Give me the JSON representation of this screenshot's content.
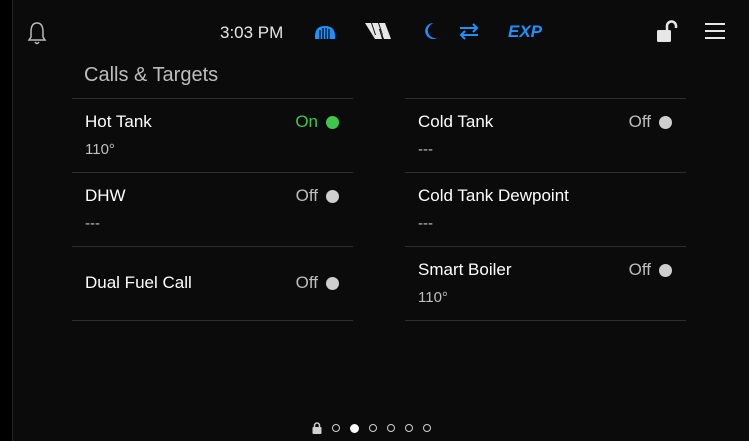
{
  "status": {
    "time": "3:03 PM",
    "exp_label": "EXP",
    "icons": [
      "bell-icon",
      "heater-icon",
      "w-logo-icon",
      "moon-icon",
      "exchange-arrows-icon",
      "lock-open-icon",
      "menu-icon"
    ],
    "accent": "#1e90ff"
  },
  "section": {
    "title": "Calls & Targets"
  },
  "left_cards": [
    {
      "label": "Hot Tank",
      "value": "110°",
      "status": "On"
    },
    {
      "label": "DHW",
      "value": "---",
      "status": "Off"
    },
    {
      "label": "Dual Fuel Call",
      "status": "Off"
    }
  ],
  "right_cards": [
    {
      "label": "Cold Tank",
      "value": "---",
      "status": "Off"
    },
    {
      "label": "Cold Tank Dewpoint",
      "value": "---"
    },
    {
      "label": "Smart Boiler",
      "value": "110°",
      "status": "Off"
    }
  ],
  "colors": {
    "on": "#3ec74a",
    "off": "#cfcfcf"
  },
  "pager": {
    "pages": 6,
    "active": 1
  }
}
